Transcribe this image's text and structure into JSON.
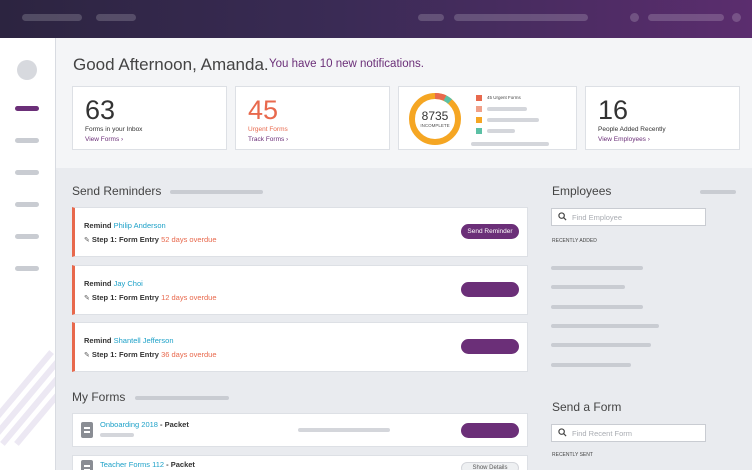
{
  "header": {
    "greeting": "Good Afternoon, Amanda.",
    "notification": "You have 10 new notifications."
  },
  "stats": [
    {
      "value": "63",
      "label": "Forms in your Inbox",
      "link": "View Forms ›"
    },
    {
      "value": "45",
      "label": "Urgent Forms",
      "link": "Track Forms ›"
    },
    {
      "value": "8735",
      "label": "INCOMPLETE",
      "legend_title": "45 Urgent Forms"
    },
    {
      "value": "16",
      "label": "People Added Recently",
      "link": "View Employees ›"
    }
  ],
  "donut_colors": [
    "#f5a623",
    "#e8694d",
    "#f0a088",
    "#5bc0a5"
  ],
  "reminders": {
    "title": "Send Reminders",
    "items": [
      {
        "prefix": "Remind",
        "person": "Philip Anderson",
        "step": "Step 1: Form Entry",
        "overdue": "52 days overdue",
        "button": "Send Reminder"
      },
      {
        "prefix": "Remind",
        "person": "Jay Choi",
        "step": "Step 1: Form Entry",
        "overdue": "12 days overdue",
        "button": ""
      },
      {
        "prefix": "Remind",
        "person": "Shantell Jefferson",
        "step": "Step 1: Form Entry",
        "overdue": "36 days overdue",
        "button": ""
      }
    ]
  },
  "my_forms": {
    "title": "My Forms",
    "items": [
      {
        "name": "Onboarding 2018",
        "suffix": " - Packet",
        "button": ""
      },
      {
        "name": "Teacher Forms 112",
        "suffix": " - Packet",
        "button": "Show Details"
      }
    ]
  },
  "employees": {
    "title": "Employees",
    "search_placeholder": "Find Employee",
    "recent_label": "RECENTLY ADDED"
  },
  "send_form": {
    "title": "Send a Form",
    "search_placeholder": "Find Recent Form",
    "recent_label": "RECENTLY SENT"
  },
  "colors": {
    "accent": "#6b2f78",
    "urgent": "#e8694d",
    "link": "#1da1c8"
  }
}
